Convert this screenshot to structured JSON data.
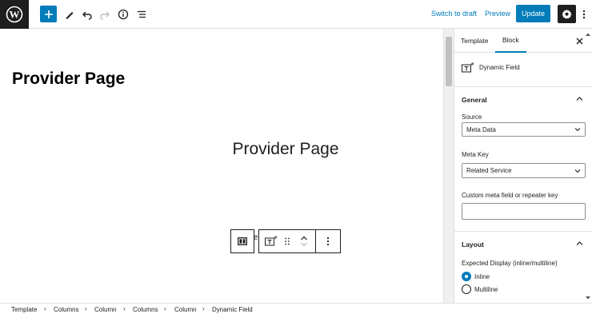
{
  "header": {
    "switch_to_draft": "Switch to draft",
    "preview": "Preview",
    "update": "Update",
    "icons": [
      "wordpress-logo",
      "plus",
      "pencil",
      "undo",
      "redo",
      "info",
      "list-view",
      "gear",
      "more-vertical"
    ]
  },
  "canvas": {
    "heading": "Provider Page",
    "center_title": "Provider Page",
    "partial_char": "e"
  },
  "sidebar": {
    "tabs": [
      "Template",
      "Block"
    ],
    "active_tab": "Block",
    "block_name": "Dynamic Field",
    "general": {
      "title": "General",
      "source_label": "Source",
      "source_value": "Meta Data",
      "meta_key_label": "Meta Key",
      "meta_key_value": "Related Service",
      "custom_label": "Custom meta field or repeater key",
      "custom_value": ""
    },
    "layout": {
      "title": "Layout",
      "expected_display_label": "Expected Display (inline/multiline)",
      "options": [
        "Inline",
        "Multiline"
      ],
      "selected": "Inline"
    }
  },
  "breadcrumb": [
    "Template",
    "Columns",
    "Column",
    "Columns",
    "Column",
    "Dynamic Field"
  ],
  "colors": {
    "accent": "#007cba",
    "dark": "#1e1e1e",
    "border": "#e0e0e0"
  }
}
